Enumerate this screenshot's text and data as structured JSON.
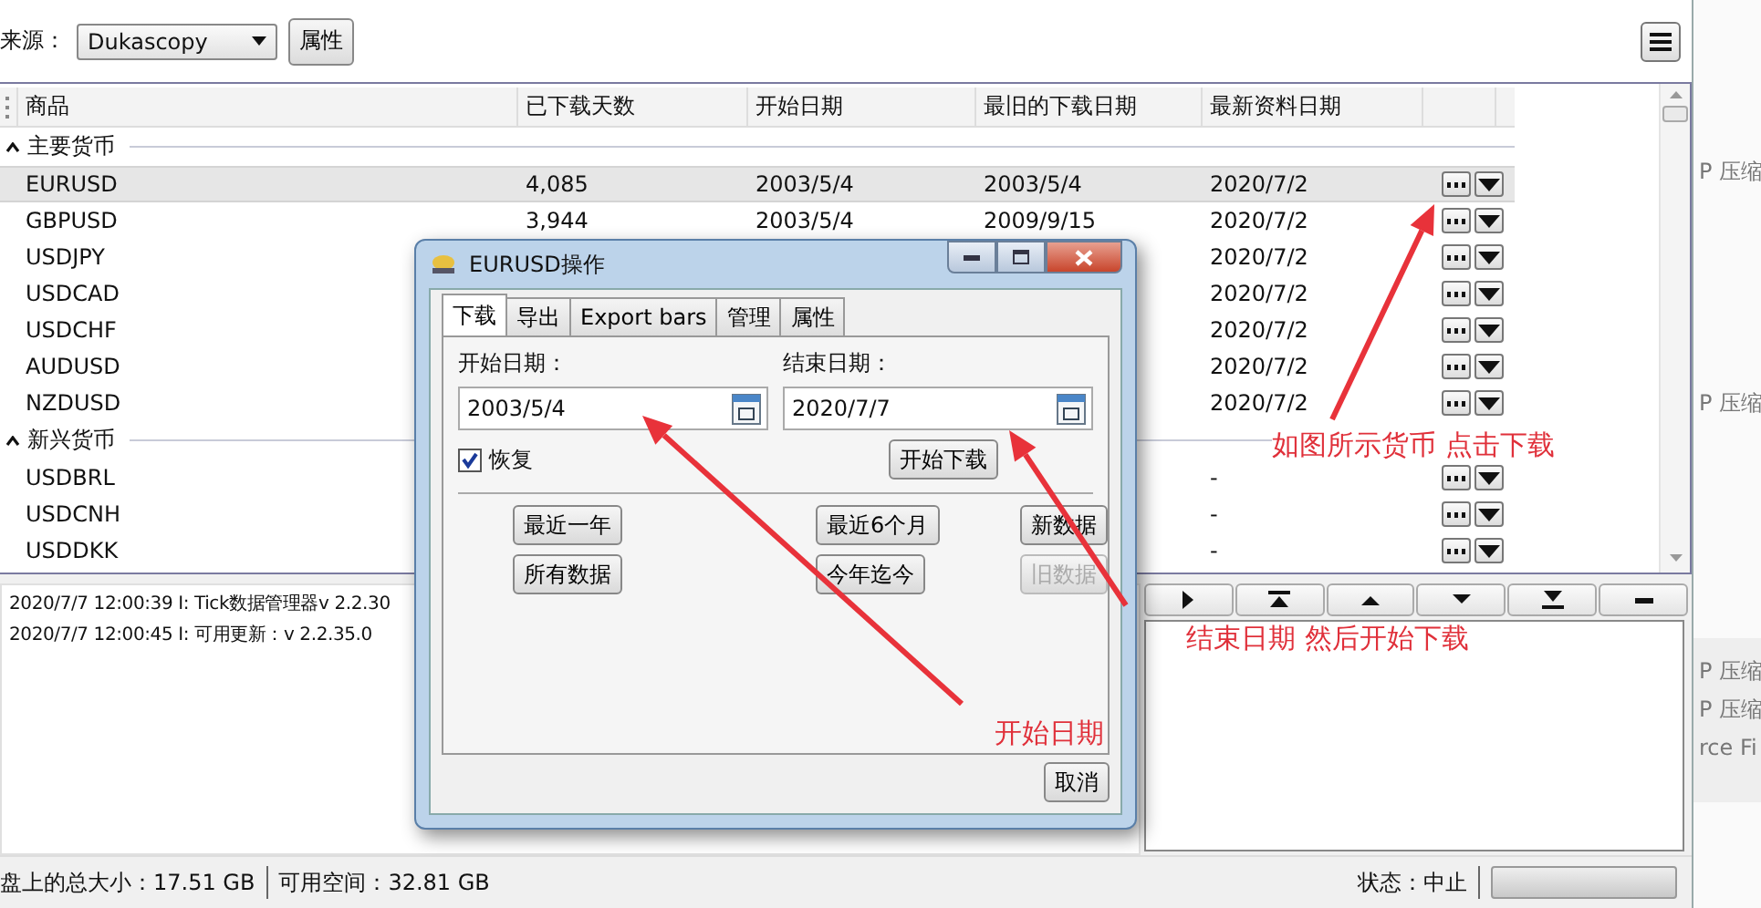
{
  "source": {
    "label": "来源：",
    "value": "Dukascopy",
    "button": "属性"
  },
  "table": {
    "columns": [
      "商品",
      "已下载天数",
      "开始日期",
      "最旧的下载日期",
      "最新资料日期"
    ],
    "groups": [
      {
        "name": "主要货币",
        "expanded": true,
        "rows": [
          {
            "symbol": "EURUSD",
            "days": "4,085",
            "start": "2003/5/4",
            "oldest": "2003/5/4",
            "latest": "2020/7/2",
            "selected": true
          },
          {
            "symbol": "GBPUSD",
            "days": "3,944",
            "start": "2003/5/4",
            "oldest": "2009/9/15",
            "latest": "2020/7/2",
            "selected": false
          },
          {
            "symbol": "USDJPY",
            "latest": "2020/7/2",
            "selected": false
          },
          {
            "symbol": "USDCAD",
            "latest": "2020/7/2",
            "selected": false
          },
          {
            "symbol": "USDCHF",
            "latest": "2020/7/2",
            "selected": false
          },
          {
            "symbol": "AUDUSD",
            "latest": "2020/7/2",
            "selected": false
          },
          {
            "symbol": "NZDUSD",
            "latest": "2020/7/2",
            "selected": false
          }
        ]
      },
      {
        "name": "新兴货币",
        "expanded": true,
        "rows": [
          {
            "symbol": "USDBRL",
            "latest": "-",
            "selected": false
          },
          {
            "symbol": "USDCNH",
            "latest": "-",
            "selected": false
          },
          {
            "symbol": "USDDKK",
            "latest": "-",
            "selected": false
          }
        ]
      }
    ]
  },
  "log": [
    "2020/7/7 12:00:39  I: Tick数据管理器v 2.2.30",
    "2020/7/7 12:00:45  I: 可用更新：v 2.2.35.0"
  ],
  "status": {
    "disk_size": "盘上的总大小：17.51 GB",
    "free_space": "可用空间：32.81 GB",
    "state": "状态：中止",
    "progress": {
      "level": 0
    }
  },
  "dialog": {
    "title": "EURUSD操作",
    "tabs": [
      {
        "label": "下载",
        "selected": true
      },
      {
        "label": "导出",
        "selected": false
      },
      {
        "label": "Export bars",
        "selected": false
      },
      {
        "label": "管理",
        "selected": false
      },
      {
        "label": "属性",
        "selected": false
      }
    ],
    "start_label": "开始日期：",
    "start_value": "2003/5/4",
    "end_label": "结束日期：",
    "end_value": "2020/7/7",
    "resume": {
      "label": "恢复",
      "checked": true
    },
    "download_button": "开始下载",
    "range_buttons": [
      {
        "label": "最近一年",
        "disabled": false
      },
      {
        "label": "最近6个月",
        "disabled": false
      },
      {
        "label": "新数据",
        "disabled": false
      },
      {
        "label": "所有数据",
        "disabled": false
      },
      {
        "label": "今年迄今",
        "disabled": false
      },
      {
        "label": "旧数据",
        "disabled": true
      }
    ],
    "cancel_button": "取消"
  },
  "annotations": [
    "如图所示货币 点击下载",
    "结束日期 然后开始下载",
    "开始日期"
  ],
  "background_fragments": [
    "P 压缩",
    "P 压缩",
    "P 压缩",
    "P 压缩",
    "rce Fi"
  ]
}
